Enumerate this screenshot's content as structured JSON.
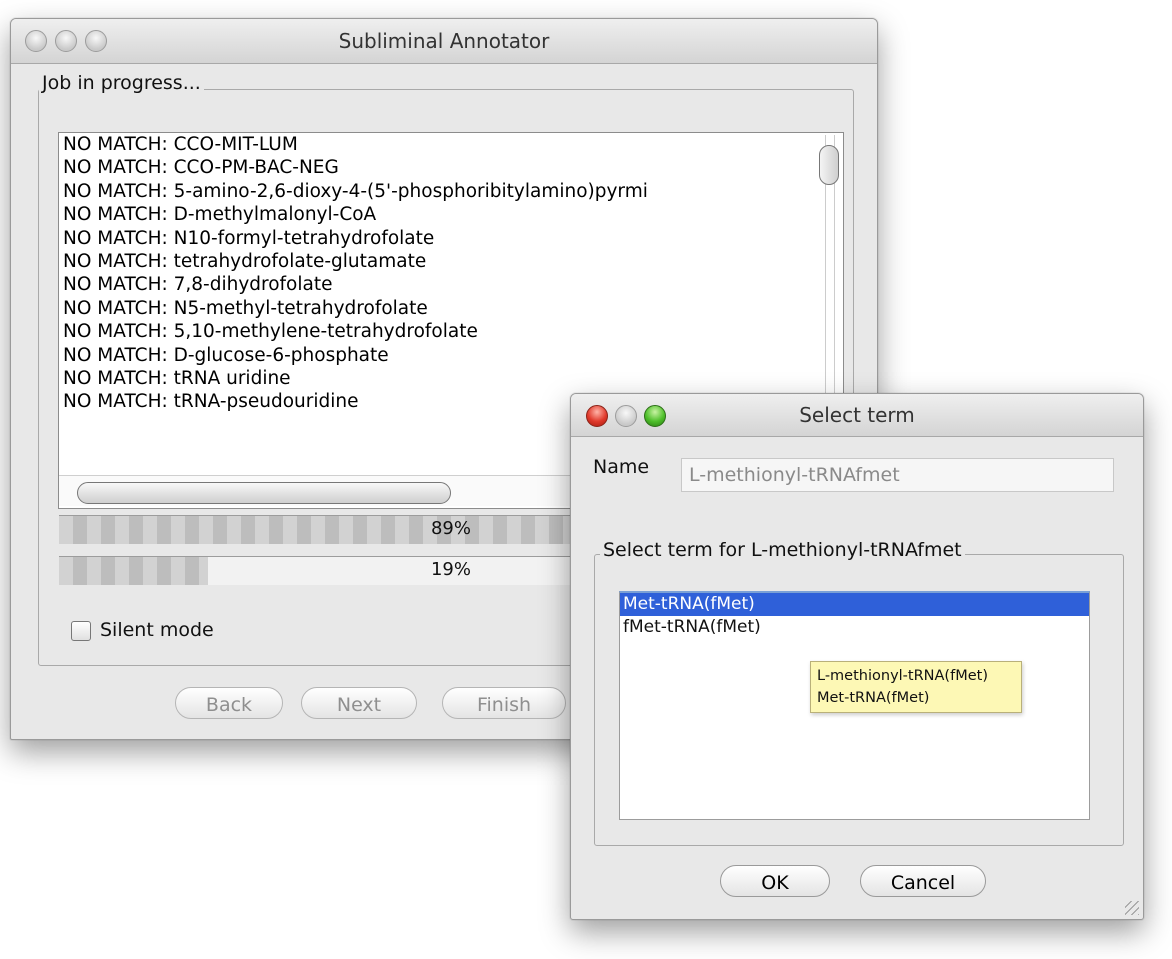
{
  "main_window": {
    "title": "Subliminal Annotator",
    "group_title": "Job in progress...",
    "log_lines": [
      "NO MATCH: CCO-MIT-LUM",
      "NO MATCH: CCO-PM-BAC-NEG",
      "NO MATCH: 5-amino-2,6-dioxy-4-(5'-phosphoribitylamino)pyrmi",
      "NO MATCH: D-methylmalonyl-CoA",
      "NO MATCH: N10-formyl-tetrahydrofolate",
      "NO MATCH: tetrahydrofolate-glutamate",
      "NO MATCH: 7,8-dihydrofolate",
      "NO MATCH: N5-methyl-tetrahydrofolate",
      "NO MATCH: 5,10-methylene-tetrahydrofolate",
      "NO MATCH: D-glucose-6-phosphate",
      "NO MATCH: tRNA uridine",
      "NO MATCH: tRNA-pseudouridine"
    ],
    "progress_1": {
      "value": 0.89,
      "label": "89%"
    },
    "progress_2": {
      "value": 0.19,
      "label": "19%"
    },
    "silent_mode": {
      "label": "Silent mode",
      "checked": false
    },
    "buttons": {
      "back": "Back",
      "next": "Next",
      "finish": "Finish"
    }
  },
  "dialog": {
    "title": "Select term",
    "name_label": "Name",
    "name_value": "L-methionyl-tRNAfmet",
    "group_title": "Select term for L-methionyl-tRNAfmet",
    "terms": [
      {
        "label": "Met-tRNA(fMet)",
        "selected": true
      },
      {
        "label": "fMet-tRNA(fMet)",
        "selected": false
      }
    ],
    "tooltip": [
      "L-methionyl-tRNA(fMet)",
      "Met-tRNA(fMet)"
    ],
    "buttons": {
      "ok": "OK",
      "cancel": "Cancel"
    }
  },
  "colors": {
    "selection": "#2f60d9",
    "tooltip_bg": "#fdf8b5",
    "window_bg": "#e8e8e8"
  }
}
